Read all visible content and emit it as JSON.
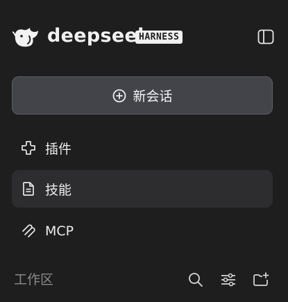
{
  "header": {
    "brand": "deepseek",
    "badge": "HARNESS"
  },
  "new_chat": {
    "label": "新会话"
  },
  "nav": [
    {
      "label": "插件",
      "icon": "plugin-icon"
    },
    {
      "label": "技能",
      "icon": "document-icon"
    },
    {
      "label": "MCP",
      "icon": "mcp-icon"
    }
  ],
  "workspace": {
    "title": "工作区"
  },
  "colors": {
    "background": "#1e1e1e",
    "new_chat_bg": "#43444a",
    "active_item_bg": "#2d2d2f",
    "muted_text": "#8a8a8a"
  }
}
